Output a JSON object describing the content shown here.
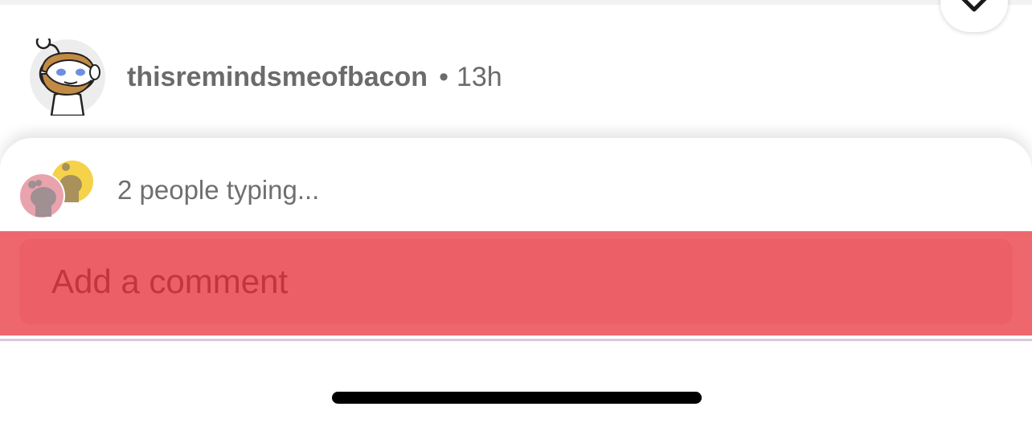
{
  "comment": {
    "author": "thisremindsmeofbacon",
    "separator": "•",
    "time": "13h"
  },
  "typing": {
    "text": "2 people typing..."
  },
  "composer": {
    "placeholder": "Add a comment"
  },
  "icons": {
    "author_avatar": "snoo-avatar-icon",
    "typing_avatar_1": "snoo-avatar-icon",
    "typing_avatar_2": "snoo-avatar-icon",
    "floating_button": "chevron-down-icon"
  },
  "colors": {
    "comment_bar": "#ee676d",
    "comment_input": "#ec5f66",
    "placeholder": "#c2353d",
    "text_secondary": "#6b6b6b",
    "typing_avatar_pink": "#e9a3ad",
    "typing_avatar_yellow": "#f6d24a"
  }
}
